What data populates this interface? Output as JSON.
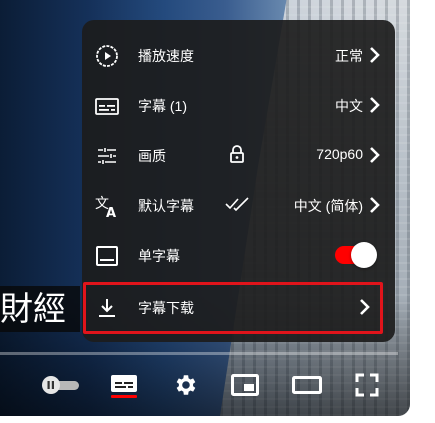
{
  "video": {
    "caption_fragment": "財經"
  },
  "settings_menu": {
    "items": [
      {
        "id": "playback_speed",
        "icon": "play-circle-icon",
        "label": "播放速度",
        "value": "正常"
      },
      {
        "id": "subtitles",
        "icon": "subtitles-icon",
        "label": "字幕 (1)",
        "value": "中文"
      },
      {
        "id": "quality",
        "icon": "sliders-icon",
        "label": "画质",
        "middle_icon": "lock-icon",
        "value": "720p60"
      },
      {
        "id": "default_subtitles",
        "icon": "translate-icon",
        "label": "默认字幕",
        "middle_icon": "double-check-icon",
        "value": "中文 (简体)"
      },
      {
        "id": "single_subtitle",
        "icon": "caption-box-icon",
        "label": "单字幕",
        "toggle_on": true
      },
      {
        "id": "subtitle_download",
        "icon": "download-icon",
        "label": "字幕下载",
        "highlighted": true
      }
    ]
  },
  "controls": {
    "icons": [
      "autoplay-toggle-icon",
      "subtitles-cc-icon",
      "settings-gear-icon",
      "miniplayer-icon",
      "theater-mode-icon",
      "fullscreen-icon"
    ],
    "accent_color": "#ff0000",
    "highlight_color": "#e0141b"
  }
}
